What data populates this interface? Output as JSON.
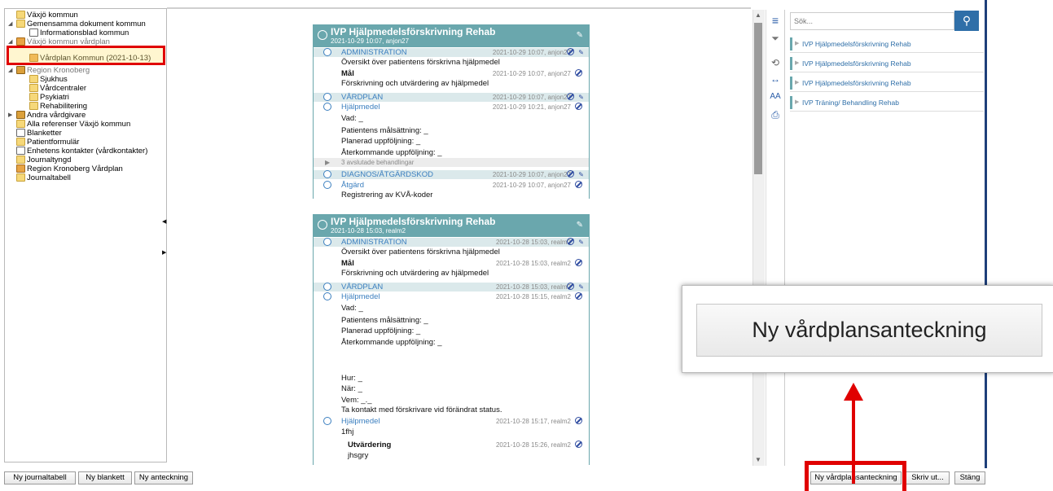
{
  "tree": {
    "items": [
      {
        "label": "Växjö kommun",
        "icon": "folder"
      },
      {
        "label": "Gemensamma dokument kommun",
        "icon": "folder"
      },
      {
        "label": "Informationsblad kommun",
        "icon": "doc"
      },
      {
        "label": "Växjö kommun vårdplan",
        "icon": "plan"
      },
      {
        "label": "Vårdplan Kommun (2021-10-13)",
        "icon": "plan"
      },
      {
        "label": "Region Kronoberg",
        "icon": "region"
      },
      {
        "label": "Sjukhus",
        "icon": "folder"
      },
      {
        "label": "Vårdcentraler",
        "icon": "folder"
      },
      {
        "label": "Psykiatri",
        "icon": "folder"
      },
      {
        "label": "Rehabilitering",
        "icon": "folder"
      },
      {
        "label": "Andra vårdgivare",
        "icon": "region"
      },
      {
        "label": "Alla referenser Växjö kommun",
        "icon": "folder"
      },
      {
        "label": "Blanketter",
        "icon": "doc"
      },
      {
        "label": "Patientformulär",
        "icon": "folder"
      },
      {
        "label": "Enhetens kontakter (vårdkontakter)",
        "icon": "doc"
      },
      {
        "label": "Journaltyngd",
        "icon": "folder"
      },
      {
        "label": "Region Kronoberg Vårdplan",
        "icon": "plan"
      },
      {
        "label": "Journaltabell",
        "icon": "folder"
      }
    ]
  },
  "bottom_left_buttons": [
    "Ny journaltabell",
    "Ny blankett",
    "Ny anteckning"
  ],
  "bottom_right_buttons": [
    "Ny vårdplansanteckning",
    "Skriv ut...",
    "Stäng"
  ],
  "card1": {
    "title": "IVP Hjälpmedelsförskrivning Rehab",
    "subtitle": "2021-10-29 10:07, anjon27",
    "rows": [
      {
        "text": "ADMINISTRATION",
        "meta": "2021-10-29 10:07, anjon27"
      },
      {
        "text": "Översikt över patientens förskrivna hjälpmedel"
      },
      {
        "text": "Mål",
        "meta": "2021-10-29 10:07, anjon27"
      },
      {
        "text": "Förskrivning och utvärdering av hjälpmedel"
      },
      {
        "text": "VÅRDPLAN",
        "meta": "2021-10-29 10:07, anjon27"
      },
      {
        "text": "Hjälpmedel",
        "meta": "2021-10-29 10:21, anjon27"
      },
      {
        "text": "Vad: _"
      },
      {
        "text": "Patientens målsättning: _"
      },
      {
        "text": "Planerad uppföljning: _"
      },
      {
        "text": "Återkommande uppföljning: _"
      },
      {
        "text": "3 avslutade behandlingar"
      },
      {
        "text": "DIAGNOS/ÅTGÄRDSKOD",
        "meta": "2021-10-29 10:07, anjon27"
      },
      {
        "text": "Åtgärd",
        "meta": "2021-10-29 10:07, anjon27"
      },
      {
        "text": "Registrering av KVÅ-koder"
      }
    ]
  },
  "card2": {
    "title": "IVP Hjälpmedelsförskrivning Rehab",
    "subtitle": "2021-10-28 15:03, realm2",
    "rows": [
      {
        "text": "ADMINISTRATION",
        "meta": "2021-10-28 15:03, realm2"
      },
      {
        "text": "Översikt över patientens förskrivna hjälpmedel"
      },
      {
        "text": "Mål",
        "meta": "2021-10-28 15:03, realm2"
      },
      {
        "text": "Förskrivning och utvärdering av hjälpmedel"
      },
      {
        "text": "VÅRDPLAN",
        "meta": "2021-10-28 15:03, realm2"
      },
      {
        "text": "Hjälpmedel",
        "meta": "2021-10-28 15:15, realm2"
      },
      {
        "text": "Vad: _"
      },
      {
        "text": "Patientens målsättning: _"
      },
      {
        "text": "Planerad uppföljning: _"
      },
      {
        "text": "Återkommande uppföljning: _"
      },
      {
        "text": "Hur: _"
      },
      {
        "text": "När: _"
      },
      {
        "text": "Vem: _._"
      },
      {
        "text": "Ta kontakt med förskrivare vid förändrat status."
      },
      {
        "text": "Hjälpmedel",
        "meta": "2021-10-28 15:17, realm2"
      },
      {
        "text": "1fhj"
      },
      {
        "text": "Utvärdering",
        "meta": "2021-10-28 15:26, realm2"
      },
      {
        "text": "jhsgry"
      }
    ]
  },
  "search": {
    "placeholder": "Sök..."
  },
  "documents": [
    "IVP Hjälpmedelsförskrivning Rehab",
    "IVP Hjälpmedelsförskrivning Rehab",
    "IVP Hjälpmedelsförskrivning Rehab",
    "IVP Träning/ Behandling Rehab"
  ],
  "callout": {
    "label": "Ny vårdplansanteckning"
  },
  "colors": {
    "highlight": "#e00000",
    "card_header": "#6aa7ad",
    "link": "#3b7fbf"
  }
}
